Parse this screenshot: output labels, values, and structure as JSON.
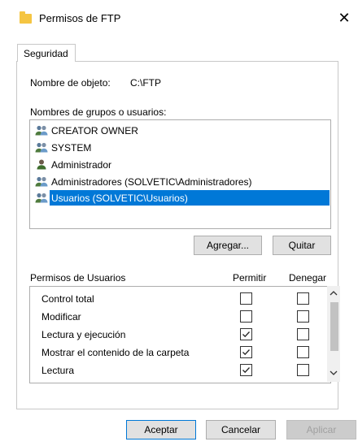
{
  "window": {
    "title": "Permisos de FTP",
    "close_glyph": "✕"
  },
  "tabs": [
    {
      "label": "Seguridad"
    }
  ],
  "object": {
    "label": "Nombre de objeto:",
    "value": "C:\\FTP"
  },
  "groups": {
    "label": "Nombres de grupos o usuarios:",
    "items": [
      {
        "label": "CREATOR OWNER",
        "icon": "users-icon"
      },
      {
        "label": "SYSTEM",
        "icon": "users-icon"
      },
      {
        "label": "Administrador",
        "icon": "user-icon"
      },
      {
        "label": "Administradores (SOLVETIC\\Administradores)",
        "icon": "users-icon"
      },
      {
        "label": "Usuarios (SOLVETIC\\Usuarios)",
        "icon": "users-icon",
        "selected": true
      }
    ]
  },
  "buttons": {
    "add": "Agregar...",
    "remove": "Quitar",
    "ok": "Aceptar",
    "cancel": "Cancelar",
    "apply": "Aplicar"
  },
  "permissions": {
    "title": "Permisos de Usuarios",
    "allow_header": "Permitir",
    "deny_header": "Denegar",
    "rows": [
      {
        "label": "Control total",
        "allow": false,
        "deny": false
      },
      {
        "label": "Modificar",
        "allow": false,
        "deny": false
      },
      {
        "label": "Lectura y ejecución",
        "allow": true,
        "deny": false
      },
      {
        "label": "Mostrar el contenido de la carpeta",
        "allow": true,
        "deny": false
      },
      {
        "label": "Lectura",
        "allow": true,
        "deny": false
      }
    ]
  },
  "colors": {
    "selection": "#0078d7",
    "folder": "#f5c542"
  }
}
